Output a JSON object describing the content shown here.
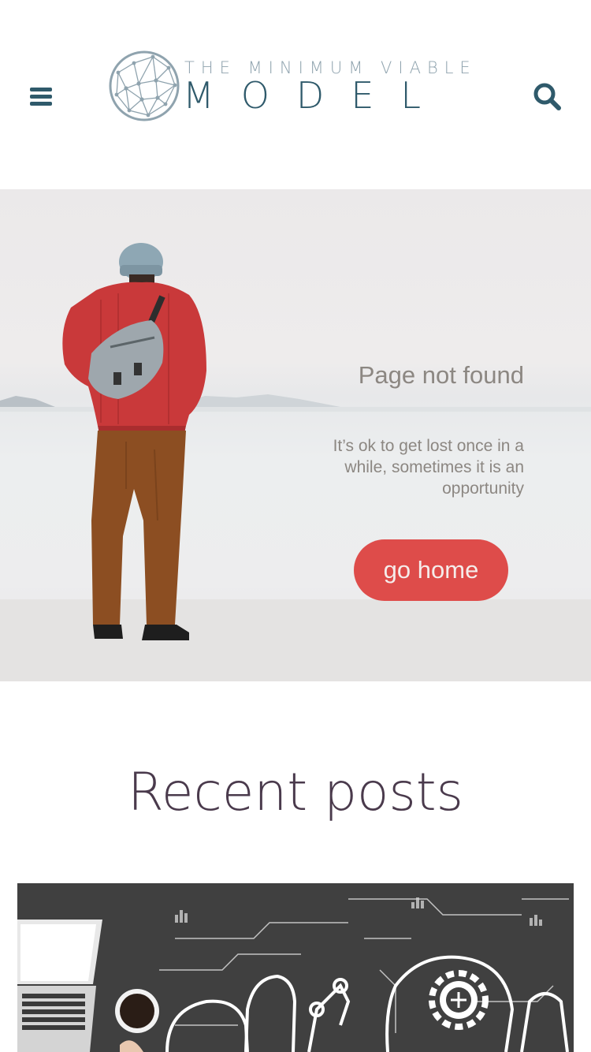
{
  "header": {
    "menu_icon": "hamburger-menu-icon",
    "search_icon": "search-icon",
    "logo_top": "THE MINIMUM VIABLE",
    "logo_main": "MODEL"
  },
  "hero": {
    "title": "Page not found",
    "text": "It’s ok to get lost once in a while, sometimes it is an opportunity",
    "button_label": "go home",
    "button_color": "#de4c4a"
  },
  "recent": {
    "title": "Recent posts"
  },
  "colors": {
    "brand": "#2f5a6b",
    "heading": "#4a3a4c"
  }
}
